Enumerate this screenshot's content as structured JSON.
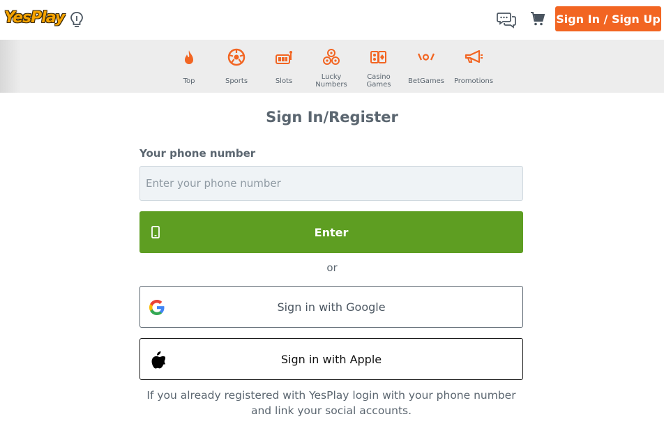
{
  "header": {
    "logo_text": "YesPlay",
    "signin_label": "Sign In / Sign Up",
    "icons": [
      "lightbulb-icon",
      "chat-icon",
      "cart-icon"
    ]
  },
  "nav": {
    "items": [
      {
        "label": "Top",
        "icon": "fire-icon"
      },
      {
        "label": "Sports",
        "icon": "soccer-ball-icon"
      },
      {
        "label": "Slots",
        "icon": "slot-machine-icon"
      },
      {
        "label": "Lucky Numbers",
        "icon": "lottery-balls-icon"
      },
      {
        "label": "Casino Games",
        "icon": "casino-cards-icon"
      },
      {
        "label": "BetGames",
        "icon": "betgames-icon"
      },
      {
        "label": "Promotions",
        "icon": "megaphone-icon"
      }
    ],
    "accent": "#f26522"
  },
  "form": {
    "title": "Sign In/Register",
    "phone_label": "Your phone number",
    "phone_placeholder": "Enter your phone number",
    "phone_value": "",
    "enter_label": "Enter",
    "or_text": "or",
    "google_label": "Sign in with Google",
    "apple_label": "Sign in with Apple",
    "note": "If you already registered with YesPlay login with your phone number and link your social accounts."
  },
  "colors": {
    "accent": "#f26522",
    "primary_button": "#5e9e22",
    "text": "#5b6670",
    "nav_bg": "#ededed",
    "input_bg": "#eff3f6"
  }
}
